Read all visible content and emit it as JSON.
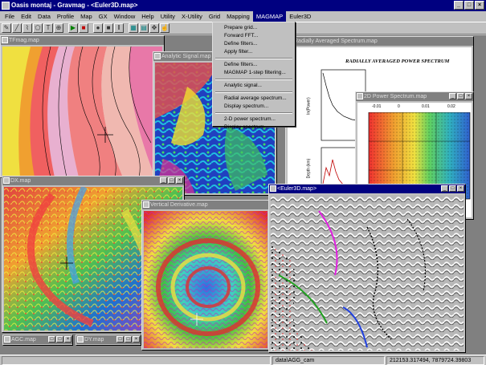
{
  "app": {
    "title": "Oasis montaj - Gravmag - <Euler3D.map>",
    "title_buttons": [
      "_",
      "□",
      "×"
    ]
  },
  "menubar": {
    "items": [
      "File",
      "Edit",
      "Data",
      "Profile",
      "Map",
      "GX",
      "Window",
      "Help",
      "Utility",
      "X-Utility",
      "Grid",
      "Mapping",
      "MAGMAP",
      "Euler3D"
    ],
    "active": "MAGMAP"
  },
  "magmap_menu": {
    "groups": [
      [
        "Prepare grid...",
        "Forward FFT...",
        "Define filters...",
        "Apply filter..."
      ],
      [
        "Define filters...",
        "MAGMAP 1-step filtering..."
      ],
      [
        "Analytic signal..."
      ],
      [
        "Radial average spectrum...",
        "Display spectrum..."
      ],
      [
        "2-D power spectrum...",
        "Display spectrum..."
      ]
    ]
  },
  "windows": {
    "tfmag": {
      "title": "TFmag.map"
    },
    "analytic": {
      "title": "Analytic Signal.map"
    },
    "radial": {
      "title": "Radially Averaged Spectrum.map",
      "plot_title": "RADIALLY AVERAGED POWER SPECTRUM",
      "ylabel_top": "ln(Power)",
      "ylabel_bottom": "Depth (km)"
    },
    "power2d": {
      "title": "2D Power Spectrum.map",
      "xticks": [
        "-0.01",
        "0",
        "0.01",
        "0.02"
      ]
    },
    "dx": {
      "title": "DX.map"
    },
    "vdrv": {
      "title": "Vertical Derivative.map"
    },
    "euler": {
      "title": "<Euler3D.map>"
    },
    "agc": {
      "title": "AGC.map"
    },
    "dy": {
      "title": "DY.map"
    }
  },
  "statusbar": {
    "path": "data\\AGG_cam",
    "coords": "212153.317494, 7879724.39803"
  }
}
